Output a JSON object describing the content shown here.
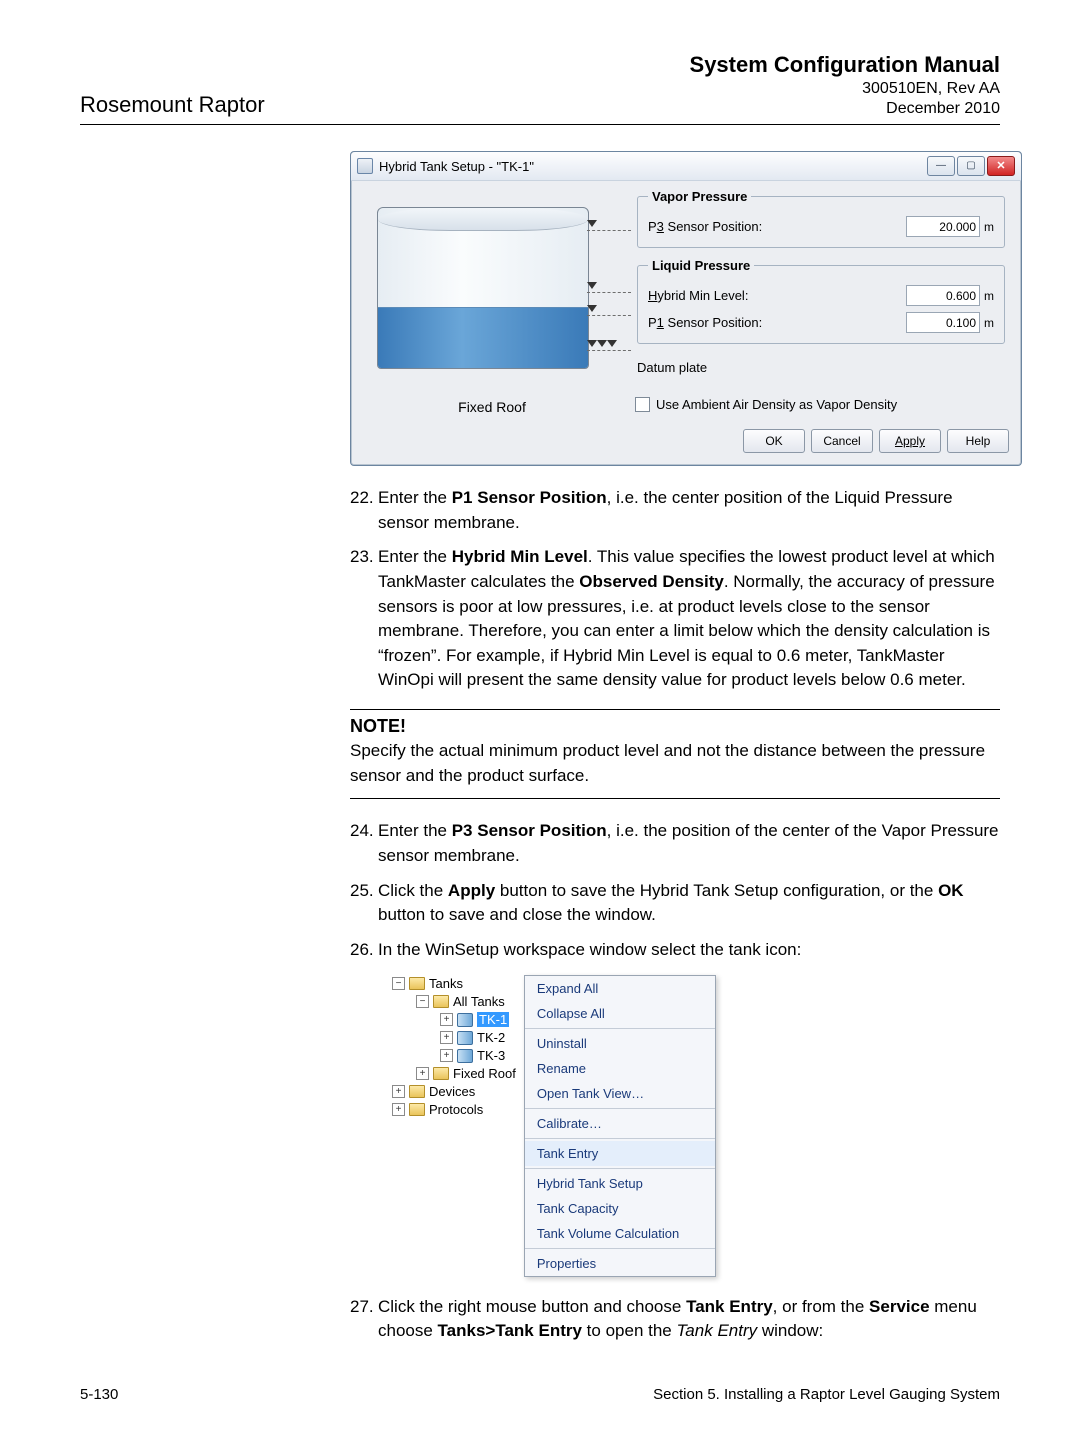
{
  "header": {
    "product": "Rosemount Raptor",
    "manual_title": "System Configuration Manual",
    "doc_id": "300510EN, Rev AA",
    "date": "December 2010"
  },
  "dialog": {
    "title": "Hybrid Tank Setup -  \"TK-1\"",
    "tank_type_label": "Fixed Roof",
    "vapor_pressure": {
      "legend": "Vapor Pressure",
      "p3_label_pre": "P",
      "p3_label_u": "3",
      "p3_label_post": " Sensor Position:",
      "p3_value": "20.000",
      "p3_unit": "m"
    },
    "liquid_pressure": {
      "legend": "Liquid Pressure",
      "hml_label_u": "H",
      "hml_label_post": "ybrid Min Level:",
      "hml_value": "0.600",
      "hml_unit": "m",
      "p1_label_pre": "P",
      "p1_label_u": "1",
      "p1_label_post": " Sensor Position:",
      "p1_value": "0.100",
      "p1_unit": "m"
    },
    "datum_label": "Datum plate",
    "checkbox_label": "Use Ambient Air Density as Vapor Density",
    "buttons": {
      "ok": "OK",
      "cancel": "Cancel",
      "apply": "Apply",
      "help": "Help"
    }
  },
  "steps_a": [
    {
      "n": "22.",
      "html": "Enter the <b>P1 Sensor Position</b>, i.e. the center position of the Liquid Pressure sensor membrane."
    },
    {
      "n": "23.",
      "html": "Enter the <b>Hybrid Min Level</b>. This value specifies the lowest product level at which TankMaster calculates the <b>Observed Density</b>. Normally, the accuracy of pressure sensors is poor at low pressures, i.e. at product levels close to the sensor membrane. Therefore, you can enter a limit below which the density calculation is “frozen”. For example, if Hybrid Min Level is equal to 0.6 meter, TankMaster WinOpi will present the same density value for product levels below 0.6 meter."
    }
  ],
  "note": {
    "heading": "NOTE!",
    "text": "Specify the actual minimum product level and not the distance between the pressure sensor and the product surface."
  },
  "steps_b": [
    {
      "n": "24.",
      "html": "Enter the <b>P3 Sensor Position</b>, i.e. the position of the center of the Vapor Pressure sensor membrane."
    },
    {
      "n": "25.",
      "html": "Click the <b>Apply</b> button to save the Hybrid Tank Setup configuration, or the <b>OK</b> button to save and close the window."
    },
    {
      "n": "26.",
      "html": "In the WinSetup workspace window select the tank icon:"
    }
  ],
  "tree": {
    "tanks": "Tanks",
    "all_tanks": "All Tanks",
    "tk1": "TK-1",
    "tk2": "TK-2",
    "tk3": "TK-3",
    "fixed_roof": "Fixed Roof",
    "devices": "Devices",
    "protocols": "Protocols"
  },
  "context_menu": {
    "expand": "Expand All",
    "collapse": "Collapse All",
    "uninstall": "Uninstall",
    "rename": "Rename",
    "open_tank_view": "Open Tank View…",
    "calibrate": "Calibrate…",
    "tank_entry": "Tank Entry",
    "hybrid": "Hybrid Tank Setup",
    "capacity": "Tank Capacity",
    "volume": "Tank Volume Calculation",
    "properties": "Properties"
  },
  "steps_c": [
    {
      "n": "27.",
      "html": "Click the right mouse button and choose <b>Tank Entry</b>, or from the <b>Service</b> menu choose <b>Tanks&gt;Tank Entry</b> to open the <i>Tank Entry</i> window:"
    }
  ],
  "footer": {
    "page": "5-130",
    "section": "Section 5. Installing a Raptor Level Gauging System"
  }
}
